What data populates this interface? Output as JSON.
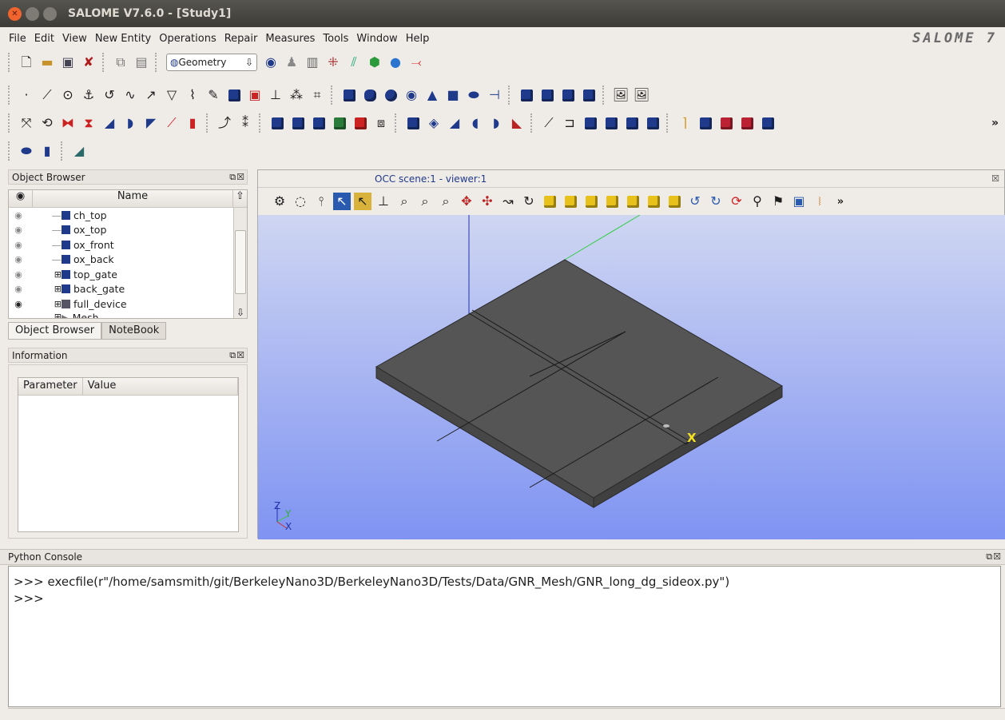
{
  "window": {
    "title": "SALOME V7.6.0 - [Study1]"
  },
  "menu": [
    "File",
    "Edit",
    "View",
    "New Entity",
    "Operations",
    "Repair",
    "Measures",
    "Tools",
    "Window",
    "Help"
  ],
  "brand": "SALOME 7",
  "toolbar": {
    "module_select": "Geometry",
    "overflow": "»"
  },
  "object_browser": {
    "title": "Object Browser",
    "column_name": "Name",
    "items": [
      {
        "label": "ch_top",
        "visible": false
      },
      {
        "label": "ox_top",
        "visible": false
      },
      {
        "label": "ox_front",
        "visible": false
      },
      {
        "label": "ox_back",
        "visible": false
      },
      {
        "label": "top_gate",
        "visible": false
      },
      {
        "label": "back_gate",
        "visible": false
      },
      {
        "label": "full_device",
        "visible": true
      },
      {
        "label": "Mesh",
        "visible": false
      }
    ],
    "tabs": [
      "Object Browser",
      "NoteBook"
    ]
  },
  "information": {
    "title": "Information",
    "columns": [
      "Parameter",
      "Value"
    ]
  },
  "viewer": {
    "tab": "OCC scene:1 - viewer:1",
    "axes": {
      "z": "Z",
      "y": "Y",
      "x": "X"
    },
    "marker": "X"
  },
  "python_console": {
    "title": "Python Console",
    "lines": [
      ">>> execfile(r\"/home/samsmith/git/BerkeleyNano3D/BerkeleyNano3D/Tests/Data/GNR_Mesh/GNR_long_dg_sideox.py\")",
      ">>>"
    ]
  },
  "colors": {
    "accent": "#1f3a8a",
    "scene_top": "#cfd6f2",
    "scene_bottom": "#7f93f2",
    "shape_top": "#555555"
  }
}
